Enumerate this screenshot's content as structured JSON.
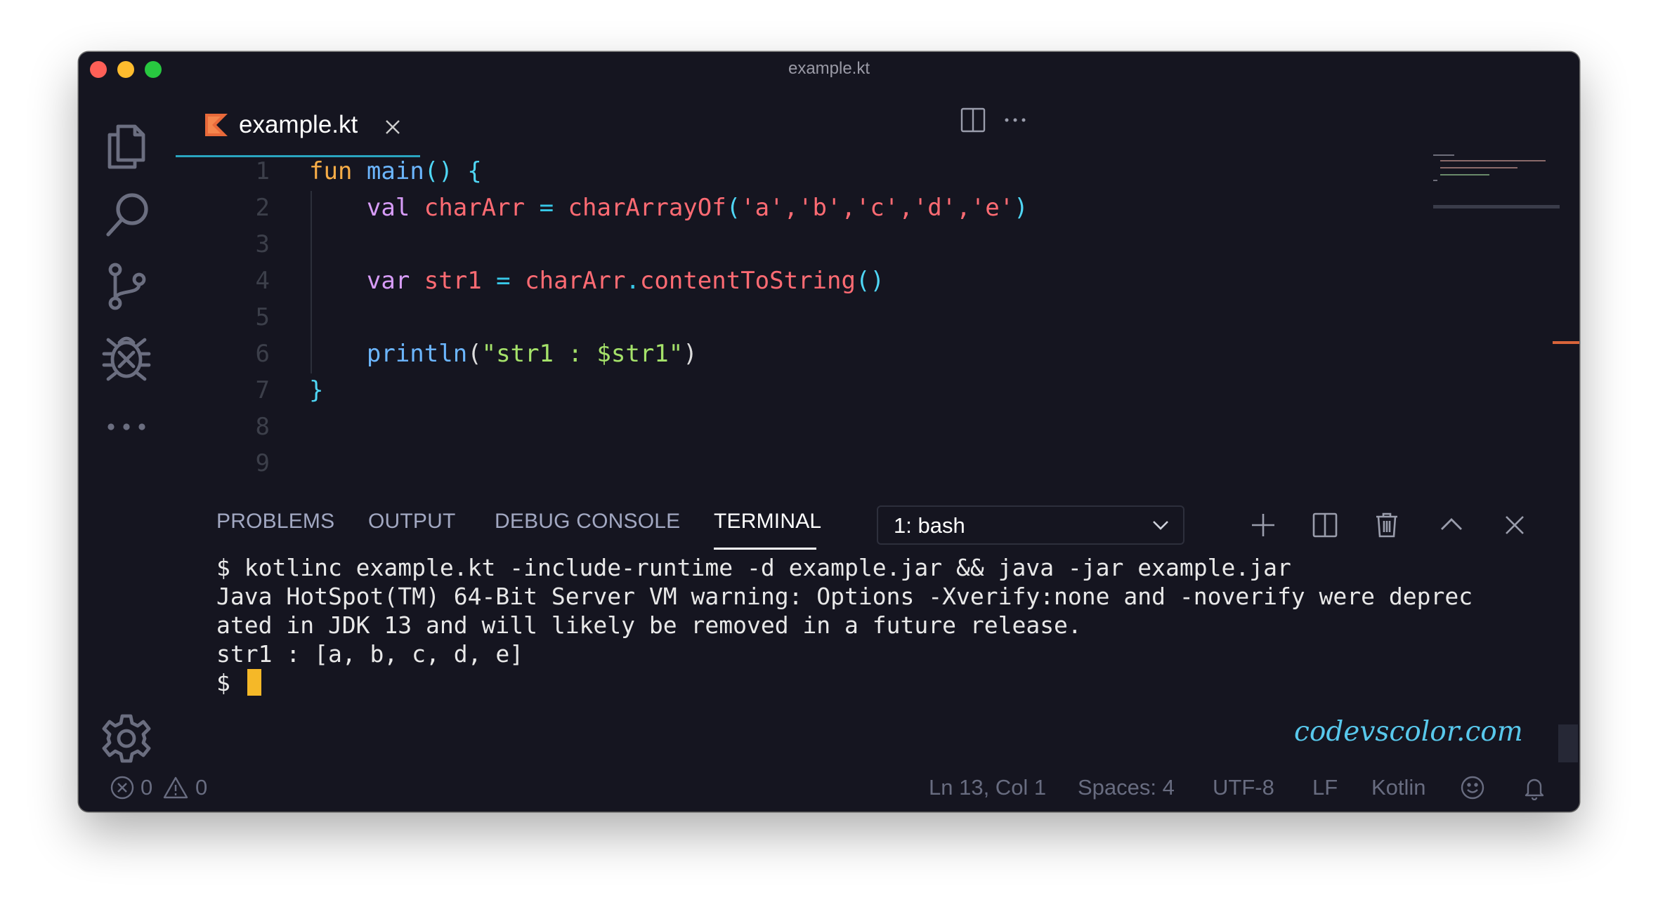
{
  "window": {
    "title": "example.kt"
  },
  "activity_bar": {
    "icons": [
      "explorer-icon",
      "search-icon",
      "source-control-icon",
      "debug-icon",
      "more-icon",
      "settings-gear-icon"
    ]
  },
  "editor": {
    "tab": {
      "label": "example.kt",
      "icon": "kotlin-file-icon"
    },
    "line_numbers": [
      "1",
      "2",
      "3",
      "4",
      "5",
      "6",
      "7",
      "8",
      "9"
    ],
    "code_lines": [
      "fun main() {",
      "    val charArr = charArrayOf('a','b','c','d','e')",
      "",
      "    var str1 = charArr.contentToString()",
      "",
      "    println(\"str1 : $str1\")",
      "}",
      "",
      ""
    ],
    "tokens": {
      "l1": {
        "kw": "fun",
        "name": "main",
        "parens": "()",
        "brace": "{"
      },
      "l2": {
        "mod": "val",
        "var": "charArr",
        "op": "=",
        "call": "charArrayOf",
        "open": "(",
        "args": "'a','b','c','d','e'",
        "close": ")"
      },
      "l4": {
        "mod": "var",
        "var": "str1",
        "op": "=",
        "recv": "charArr",
        "dot": ".",
        "call": "contentToString",
        "parens": "()"
      },
      "l6": {
        "call": "println",
        "open": "(",
        "str": "\"str1 : $str1\"",
        "close": ")"
      },
      "l7": {
        "brace": "}"
      }
    }
  },
  "panel": {
    "tabs": [
      "PROBLEMS",
      "OUTPUT",
      "DEBUG CONSOLE",
      "TERMINAL"
    ],
    "active_tab": "TERMINAL",
    "terminal_select": "1: bash",
    "actions": [
      "new-terminal-icon",
      "split-terminal-icon",
      "kill-terminal-icon",
      "maximize-panel-icon",
      "close-panel-icon"
    ],
    "terminal_lines": [
      "$ kotlinc example.kt -include-runtime -d example.jar && java -jar example.jar",
      "Java HotSpot(TM) 64-Bit Server VM warning: Options -Xverify:none and -noverify were deprec",
      "ated in JDK 13 and will likely be removed in a future release.",
      "str1 : [a, b, c, d, e]"
    ],
    "prompt": "$",
    "watermark": "codevscolor.com"
  },
  "status_bar": {
    "errors": "0",
    "warnings": "0",
    "cursor_position": "Ln 13, Col 1",
    "indentation": "Spaces: 4",
    "encoding": "UTF-8",
    "line_ending": "LF",
    "language": "Kotlin"
  },
  "colors": {
    "background": "#151520",
    "accent_tab_underline": "#2aa4bf",
    "keyword_fun": "#f8ad47",
    "keyword_modifier": "#d79cf8",
    "variable": "#ff6b73",
    "function": "#6cb6ff",
    "string": "#a5e26a",
    "cursor": "#f5b828"
  }
}
